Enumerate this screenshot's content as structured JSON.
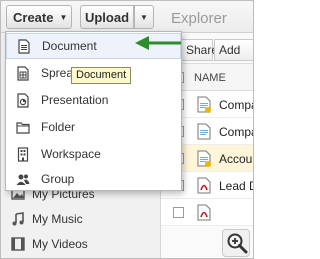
{
  "toolbar": {
    "create_label": "Create",
    "upload_label": "Upload",
    "title": "Explorer"
  },
  "actions": {
    "share_label": "Share",
    "add_label": "Add"
  },
  "table": {
    "column_name": "NAME",
    "rows": [
      {
        "name": "Compa",
        "highlighted": false,
        "icon": "document-icon"
      },
      {
        "name": "Compa",
        "highlighted": false,
        "icon": "document-icon"
      },
      {
        "name": "Accour",
        "highlighted": true,
        "icon": "document-icon"
      },
      {
        "name": "Lead D",
        "highlighted": false,
        "icon": "pdf-icon"
      },
      {
        "name": "",
        "highlighted": false,
        "icon": "pdf-icon"
      }
    ]
  },
  "create_menu": {
    "items": [
      {
        "label": "Document",
        "icon": "document-icon"
      },
      {
        "label": "Spreadsheet",
        "icon": "spreadsheet-icon"
      },
      {
        "label": "Presentation",
        "icon": "presentation-icon"
      },
      {
        "label": "Folder",
        "icon": "folder-icon"
      },
      {
        "label": "Workspace",
        "icon": "workspace-icon"
      },
      {
        "label": "Group",
        "icon": "group-icon"
      }
    ],
    "tooltip": "Document"
  },
  "sidebar": {
    "items": [
      {
        "label": "My Pictures",
        "icon": "pictures-icon"
      },
      {
        "label": "My Music",
        "icon": "music-icon"
      },
      {
        "label": "My Videos",
        "icon": "videos-icon"
      }
    ]
  },
  "colors": {
    "arrow": "#2e8b2e",
    "highlight_row": "#fff6d9",
    "tooltip_bg": "#fdf8c9"
  }
}
